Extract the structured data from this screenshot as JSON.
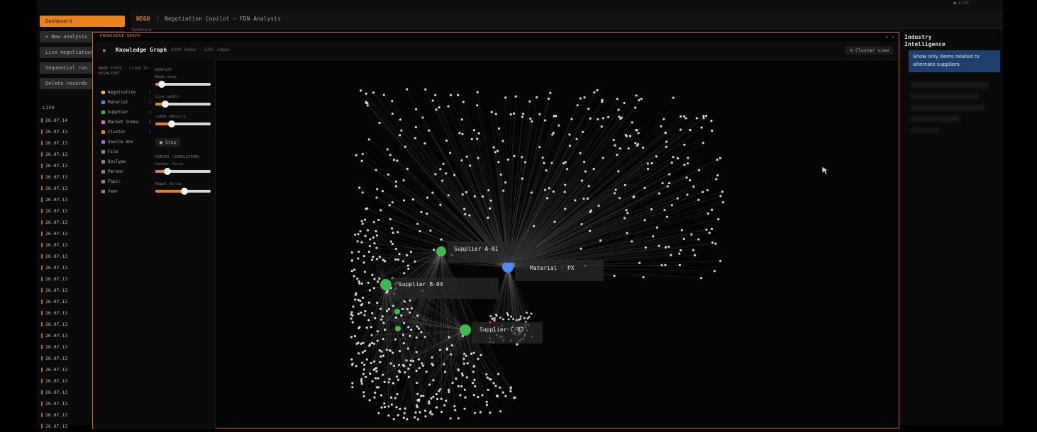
{
  "topbar": {
    "status": "● LIVE",
    "middle": "",
    "user": ""
  },
  "sidebar": {
    "buttons": [
      {
        "label": "Dashboard",
        "primary": true
      },
      {
        "label": "+ New analysis"
      },
      {
        "label": "Live negotiation"
      },
      {
        "label": "Sequential run"
      },
      {
        "label": "Delete records"
      }
    ],
    "live_label": "Live",
    "dates": [
      "26.07.14",
      "26.07.13",
      "26.07.13",
      "26.07.13",
      "26.07.13",
      "26.07.13",
      "26.07.13",
      "26.07.13",
      "26.07.13",
      "26.07.13",
      "26.07.13",
      "26.07.13",
      "26.07.13",
      "26.07.13",
      "26.07.13",
      "26.07.13",
      "26.07.13",
      "26.07.13",
      "26.07.13",
      "26.07.13",
      "26.07.13",
      "26.07.13",
      "26.07.13",
      "26.07.13",
      "26.07.13",
      "26.07.13",
      "26.07.13",
      "26.07.13"
    ]
  },
  "header": {
    "brand": "NEGO",
    "separator": "|",
    "title": "Negotiation Copilot — FDN Analysis",
    "crumb": "Dashboard"
  },
  "overlay": {
    "tag": "KNOWLEDGE GRAPH",
    "window_controls": "↔ ✕",
    "back": "■",
    "title": "Knowledge Graph",
    "counts": "4200 nodes · 2201 edges",
    "cluster_button": "⊙ Cluster view"
  },
  "controls": {
    "node_types_title": "NODE TYPES · CLICK TO HIGHLIGHT",
    "node_types": [
      {
        "label": "Negotiation",
        "count": "1",
        "color": "#e8b04a"
      },
      {
        "label": "Material",
        "count": "1",
        "color": "#4a8cf0"
      },
      {
        "label": "Supplier",
        "count": "3",
        "color": "#3fb84f"
      },
      {
        "label": "Market Index",
        "count": "8",
        "color": "#e860c8"
      },
      {
        "label": "Cluster",
        "count": "1",
        "color": "#f07a40"
      },
      {
        "label": "Source doc",
        "count": "",
        "color": "#9a6ae8"
      },
      {
        "label": "File",
        "count": "",
        "color": "#888888"
      },
      {
        "label": "DocType",
        "count": "",
        "color": "#888888"
      },
      {
        "label": "Person",
        "count": "",
        "color": "#888888"
      },
      {
        "label": "Topic",
        "count": "",
        "color": "#888888"
      },
      {
        "label": "Year",
        "count": "",
        "color": "#888888"
      }
    ],
    "display_title": "DISPLAY",
    "sliders_display": [
      {
        "label": "Node size",
        "value": 0.12
      },
      {
        "label": "Link width",
        "value": 0.18
      },
      {
        "label": "Label density",
        "value": 0.3
      }
    ],
    "stop_button": "■ Stop",
    "forces_title": "FORCES (SIMULATION)",
    "sliders_forces": [
      {
        "label": "Center force",
        "value": 0.22
      },
      {
        "label": "Repel force",
        "value": 0.52
      }
    ],
    "hint": ""
  },
  "graph": {
    "labels": {
      "supplier_a": "Supplier A-01",
      "material": "Material · PX",
      "supplier_b": "Supplier B-04",
      "supplier_c": "Supplier C-02"
    }
  },
  "industry_panel": {
    "title": "Industry Intelligence",
    "close": ""
  },
  "tooltip": {
    "text": "Show only items related to alternate suppliers"
  }
}
